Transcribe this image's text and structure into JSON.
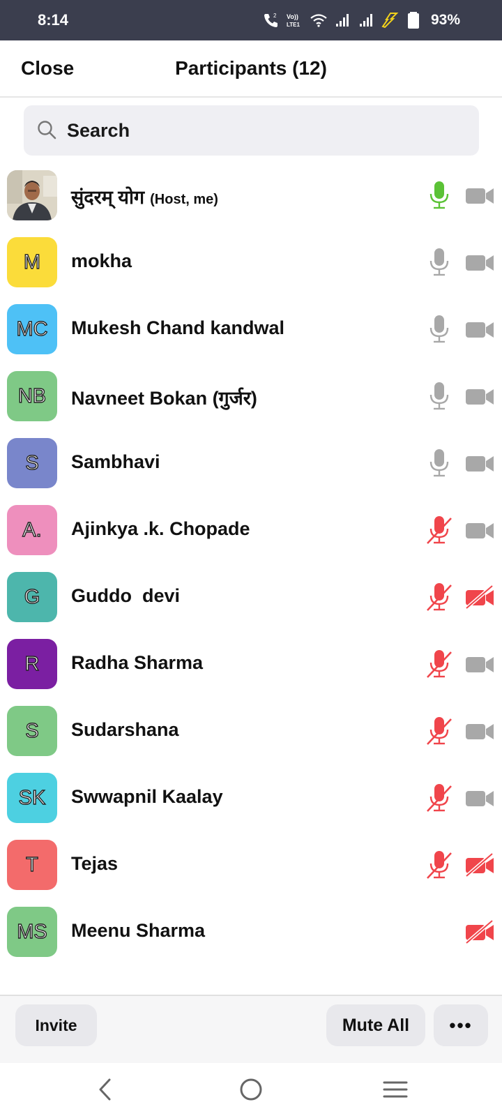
{
  "status_bar": {
    "time": "8:14",
    "battery": "93%",
    "icons": [
      "call-hd-icon",
      "volte-icon",
      "wifi-icon",
      "signal-icon",
      "signal-icon",
      "charging-icon",
      "battery-icon"
    ]
  },
  "header": {
    "close_label": "Close",
    "title": "Participants (12)"
  },
  "search": {
    "placeholder": "Search"
  },
  "participants": [
    {
      "name": "सुंदरम् योग",
      "role": "(Host, me)",
      "initials": "",
      "avatar_color": "#d8d4c8",
      "mic": "active",
      "video": "off-gray"
    },
    {
      "name": "mokha",
      "initials": "M",
      "avatar_color": "#fbdc3a",
      "mic": "gray",
      "video": "off-gray"
    },
    {
      "name": "Mukesh Chand kandwal",
      "initials": "MC",
      "avatar_color": "#4ec1f6",
      "mic": "gray",
      "video": "off-gray"
    },
    {
      "name": "Navneet Bokan (गुर्जर)",
      "initials": "NB",
      "avatar_color": "#7fc986",
      "mic": "gray",
      "video": "off-gray"
    },
    {
      "name": "Sambhavi",
      "initials": "S",
      "avatar_color": "#7986cb",
      "mic": "gray",
      "video": "off-gray"
    },
    {
      "name": "Ajinkya .k. Chopade",
      "initials": "A.",
      "avatar_color": "#ee8fbd",
      "mic": "muted",
      "video": "off-gray"
    },
    {
      "name": "Guddo  devi",
      "initials": "G",
      "avatar_color": "#4db6ac",
      "mic": "muted",
      "video": "off-red"
    },
    {
      "name": "Radha Sharma",
      "initials": "R",
      "avatar_color": "#7b1fa2",
      "mic": "muted",
      "video": "off-gray"
    },
    {
      "name": "Sudarshana",
      "initials": "S",
      "avatar_color": "#7fc986",
      "mic": "muted",
      "video": "off-gray"
    },
    {
      "name": "Swwapnil Kaalay",
      "initials": "SK",
      "avatar_color": "#4dd0e1",
      "mic": "muted",
      "video": "off-gray"
    },
    {
      "name": "Tejas",
      "initials": "T",
      "avatar_color": "#f36b6b",
      "mic": "muted",
      "video": "off-red"
    },
    {
      "name": "Meenu Sharma",
      "initials": "MS",
      "avatar_color": "#7fc986",
      "mic": "none",
      "video": "off-red"
    }
  ],
  "bottom_bar": {
    "invite_label": "Invite",
    "mute_all_label": "Mute All",
    "more_label": "•••"
  },
  "nav_bar": {
    "icons": [
      "back-icon",
      "home-icon",
      "recents-icon"
    ]
  },
  "colors": {
    "mic_active": "#5bc236",
    "icon_gray": "#a8a8a8",
    "muted_red": "#f0454b",
    "status_bar_bg": "#3b3e4e"
  }
}
